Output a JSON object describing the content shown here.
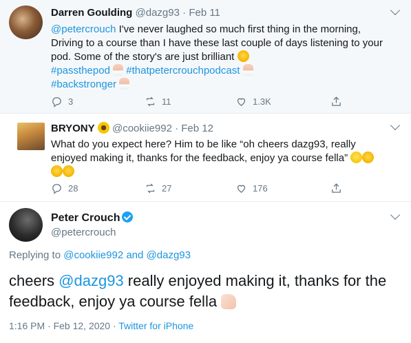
{
  "tweet1": {
    "name": "Darren Goulding",
    "handle": "@dazg93",
    "date": "Feb 11",
    "text": {
      "mention": "@petercrouch",
      "line1": " I've never laughed so much first thing in the morning,",
      "line2": "Driving to a course than I have these last couple of days listening to your",
      "line3": "pod. Some of the story's are just brilliant",
      "tag1": "#passthepod",
      "tag2": "#thatpetercrouchpodcast",
      "tag3": "#backstronger"
    },
    "replies": "3",
    "retweets": "11",
    "likes": "1.3K"
  },
  "tweet2": {
    "name": "BRYONY",
    "handle": "@cookiie992",
    "date": "Feb 12",
    "line1": "What do you expect here? Him to be like “oh cheers dazg93, really",
    "line2": "enjoyed making it, thanks for the feedback, enjoy ya course fella”",
    "replies": "28",
    "retweets": "27",
    "likes": "176"
  },
  "tweet3": {
    "name": "Peter Crouch",
    "handle": "@petercrouch",
    "replying_prefix": "Replying to ",
    "replying_user1": "@cookiie992",
    "replying_and": " and ",
    "replying_user2": "@dazg93",
    "text_start": "cheers ",
    "text_mention": "@dazg93",
    "text_rest1": " really enjoyed making it, thanks for the",
    "text_rest2": "feedback, enjoy ya course fella",
    "time": "1:16 PM · Feb 12, 2020 · ",
    "source": "Twitter for iPhone"
  },
  "colors": {
    "link": "#1b95e0",
    "muted": "#657786",
    "verified": "#1da1f2"
  }
}
